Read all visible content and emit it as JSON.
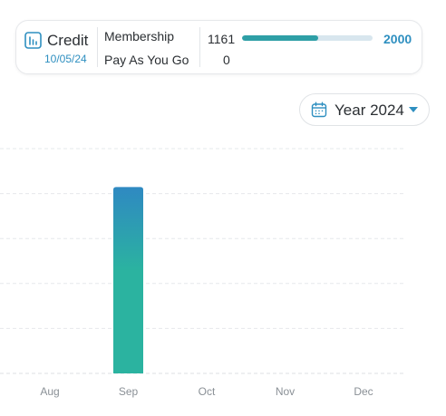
{
  "credit": {
    "title": "Credit",
    "date": "10/05/24",
    "icon": "bar-chart-icon",
    "membership_label": "Membership",
    "payg_label": "Pay As You Go",
    "membership_used": "1161",
    "membership_total": "2000",
    "membership_progress": 0.58,
    "payg_value": "0",
    "accent_color": "#2e8fc0",
    "progress_color": "#2e9fa6"
  },
  "year_selector": {
    "label": "Year 2024",
    "icon": "calendar-icon",
    "caret": "caret-down-icon"
  },
  "chart_data": {
    "type": "bar",
    "categories": [
      "Aug",
      "Sep",
      "Oct",
      "Nov",
      "Dec"
    ],
    "values": [
      0,
      1161,
      0,
      0,
      0
    ],
    "ylim": [
      0,
      1400
    ],
    "grid": true,
    "title": "",
    "xlabel": "",
    "ylabel": "",
    "bar_gradient": [
      "#2f89c2",
      "#2bb3a0"
    ]
  }
}
